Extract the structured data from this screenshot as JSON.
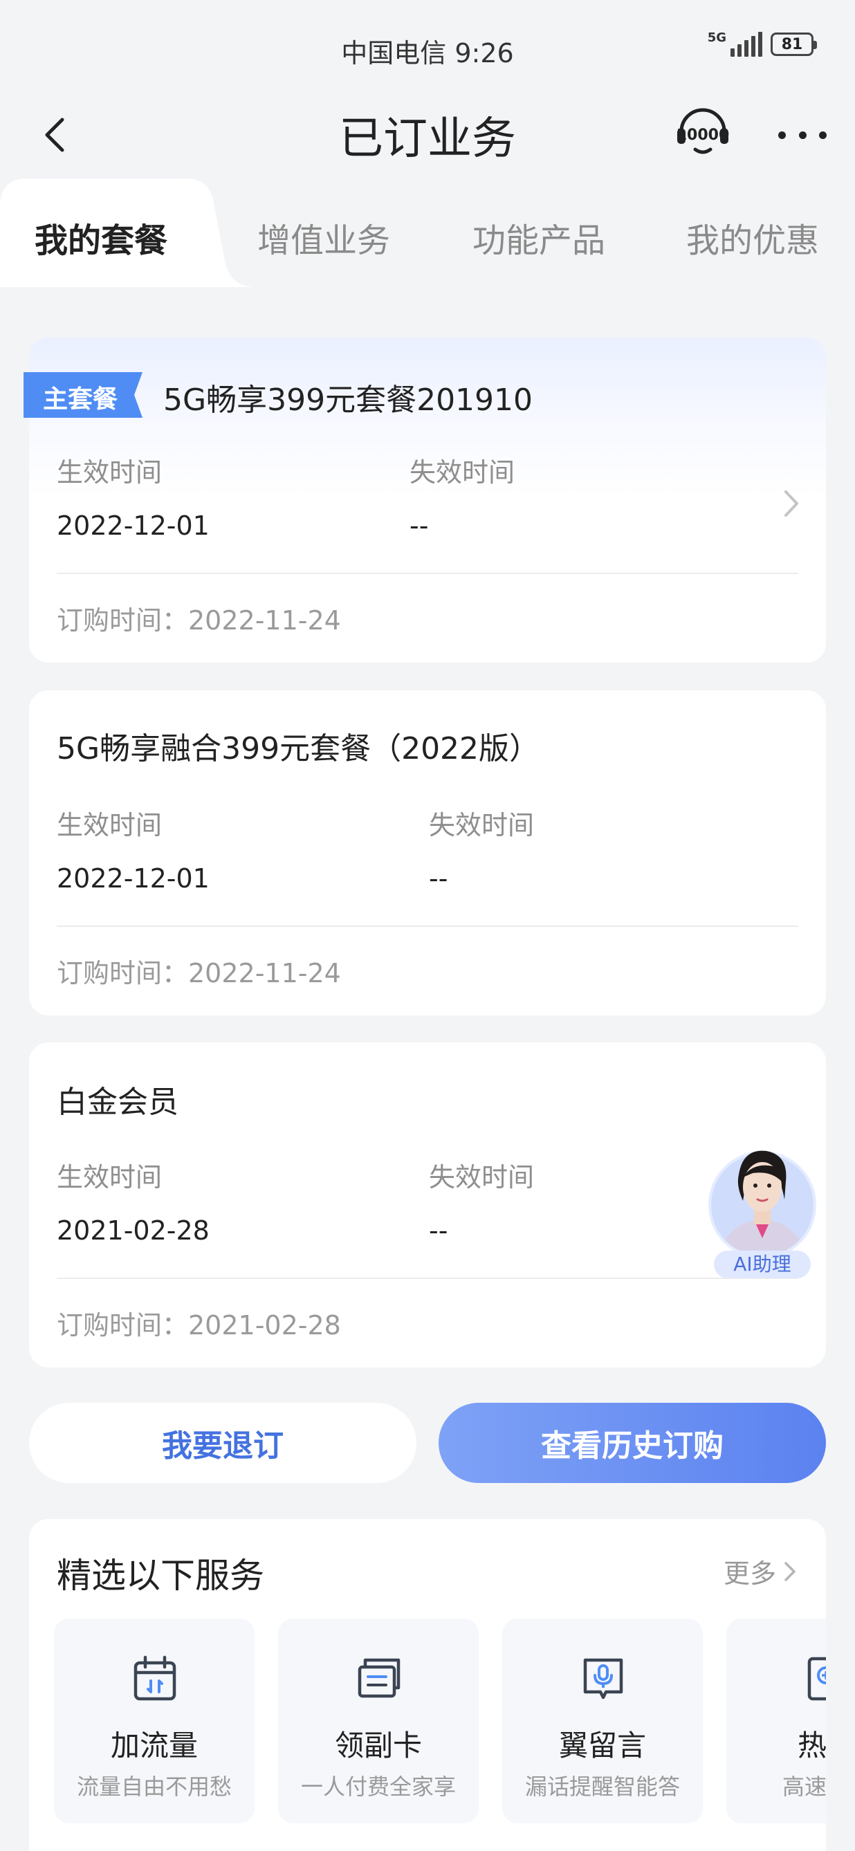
{
  "status_bar": {
    "carrier_time": "中国电信 9:26",
    "network": "5G",
    "battery": "81"
  },
  "nav": {
    "title": "已订业务",
    "service_icon": "10000-customer-service-icon",
    "more_icon": "more-dots-icon"
  },
  "tabs": [
    {
      "label": "我的套餐",
      "active": true
    },
    {
      "label": "增值业务",
      "active": false
    },
    {
      "label": "功能产品",
      "active": false
    },
    {
      "label": "我的优惠",
      "active": false
    }
  ],
  "plans": [
    {
      "tag": "主套餐",
      "name": "5G畅享399元套餐201910",
      "effective_label": "生效时间",
      "effective_value": "2022-12-01",
      "expire_label": "失效时间",
      "expire_value": "--",
      "order_time": "订购时间：2022-11-24"
    },
    {
      "name": "5G畅享融合399元套餐（2022版）",
      "effective_label": "生效时间",
      "effective_value": "2022-12-01",
      "expire_label": "失效时间",
      "expire_value": "--",
      "order_time": "订购时间：2022-11-24"
    },
    {
      "name": "白金会员",
      "effective_label": "生效时间",
      "effective_value": "2021-02-28",
      "expire_label": "失效时间",
      "expire_value": "--",
      "order_time": "订购时间：2021-02-28"
    }
  ],
  "ai_assistant": {
    "label": "AI助理"
  },
  "actions": {
    "unsubscribe": "我要退订",
    "history": "查看历史订购"
  },
  "services": {
    "title": "精选以下服务",
    "more": "更多",
    "items": [
      {
        "name": "加流量",
        "desc": "流量自由不用愁",
        "icon": "calendar-data-icon"
      },
      {
        "name": "领副卡",
        "desc": "一人付费全家享",
        "icon": "sim-card-icon"
      },
      {
        "name": "翼留言",
        "desc": "漏话提醒智能答",
        "icon": "voice-message-icon"
      },
      {
        "name": "热销",
        "desc": "高速稳定",
        "icon": "hot-product-icon"
      }
    ]
  },
  "colors": {
    "accent": "#4472e0",
    "tag_blue": "#3b82f6"
  }
}
